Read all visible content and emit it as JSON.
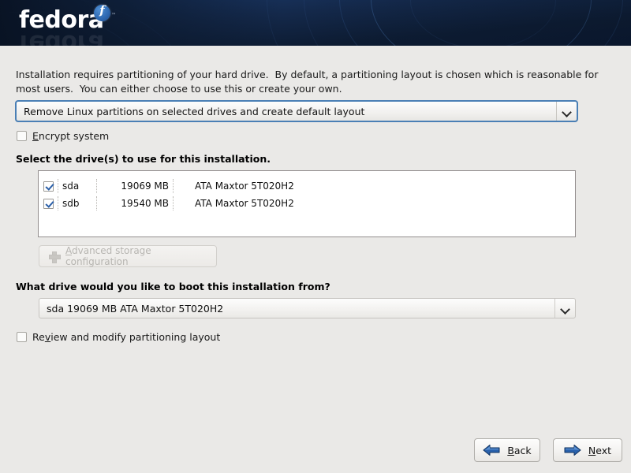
{
  "banner": {
    "logo_word": "fedora",
    "logo_badge_glyph": "f",
    "logo_tm": "™",
    "logo_badge_tm": "™",
    "logo_reflection": "fedora",
    "accent_color": "#2f6ab3",
    "background_color": "#0d1c33"
  },
  "page": {
    "background_color": "#eae9e7",
    "intro_text": "Installation requires partitioning of your hard drive.  By default, a partitioning layout is chosen which is reasonable for most users.  You can either choose to use this or create your own."
  },
  "layout_combo": {
    "name": "partitioning-layout-select",
    "value": "Remove Linux partitions on selected drives and create default layout",
    "arrow_icon": "chevron-down-icon",
    "focused": true,
    "focus_color": "#4a7fb5"
  },
  "encrypt": {
    "label_pre": "",
    "mnemonic": "E",
    "label_post": "ncrypt system",
    "checked": false
  },
  "drives_section": {
    "label": "Select the drive(s) to use for this installation.",
    "rows": [
      {
        "checked": true,
        "device": "sda",
        "size": "19069 MB",
        "model": "ATA Maxtor 5T020H2"
      },
      {
        "checked": true,
        "device": "sdb",
        "size": "19540 MB",
        "model": "ATA Maxtor 5T020H2"
      }
    ]
  },
  "advanced_button": {
    "label_pre": "",
    "mnemonic": "A",
    "label_post": "dvanced storage configuration",
    "icon": "plus-icon",
    "enabled": false
  },
  "boot_section": {
    "label": "What drive would you like to boot this installation from?",
    "value": "sda     19069 MB ATA Maxtor 5T020H2",
    "arrow_icon": "chevron-down-icon"
  },
  "review": {
    "label_pre": "Re",
    "mnemonic": "v",
    "label_post": "iew and modify partitioning layout",
    "checked": false
  },
  "nav": {
    "back": {
      "label_pre": "",
      "mnemonic": "B",
      "label_post": "ack",
      "icon": "arrow-left-icon"
    },
    "next": {
      "label_pre": "",
      "mnemonic": "N",
      "label_post": "ext",
      "icon": "arrow-right-icon"
    },
    "arrow_color": "#2a62ad"
  }
}
